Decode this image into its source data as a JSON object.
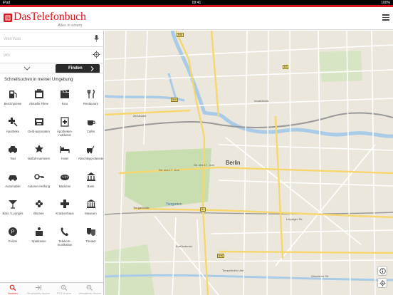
{
  "status": {
    "left": "iPad",
    "time": "09:41",
    "right": "100%"
  },
  "header": {
    "logo": "DasTelefonbuch",
    "tagline": "Alles in einem"
  },
  "search": {
    "what_placeholder": "Wer/Was",
    "where_placeholder": "Wo",
    "find_label": "Finden"
  },
  "quick": {
    "title": "Schnellsuchen in meiner Umgebung",
    "items": [
      {
        "label": "Benzinpreise",
        "icon": "gas-station-icon"
      },
      {
        "label": "Aktuelle Filme",
        "icon": "film-icon"
      },
      {
        "label": "Kino",
        "icon": "clapperboard-icon"
      },
      {
        "label": "Restaurant",
        "icon": "cutlery-icon"
      },
      {
        "label": "Apotheke",
        "icon": "pharmacy-icon"
      },
      {
        "label": "Geld-automaten",
        "icon": "atm-icon"
      },
      {
        "label": "Apotheken-notdienst",
        "icon": "pharmacy-emergency-icon"
      },
      {
        "label": "Cafés",
        "icon": "coffee-cup-icon"
      },
      {
        "label": "Taxi",
        "icon": "taxi-icon"
      },
      {
        "label": "Notfall-nummern",
        "icon": "emergency-icon"
      },
      {
        "label": "Hotel",
        "icon": "hotel-bed-icon"
      },
      {
        "label": "Abschlepp-dienste",
        "icon": "tow-truck-icon"
      },
      {
        "label": "Automobile",
        "icon": "car-icon"
      },
      {
        "label": "Autoren-Helfung",
        "icon": "key-icon"
      },
      {
        "label": "Bäckerei",
        "icon": "bread-icon"
      },
      {
        "label": "Bank",
        "icon": "bank-icon"
      },
      {
        "label": "Bars / Lounges",
        "icon": "cocktail-icon"
      },
      {
        "label": "Blumen",
        "icon": "flower-icon"
      },
      {
        "label": "Krankenhaus",
        "icon": "hospital-icon"
      },
      {
        "label": "Museum",
        "icon": "museum-icon"
      },
      {
        "label": "Polizei",
        "icon": "police-icon"
      },
      {
        "label": "Sparkasse",
        "icon": "savings-bank-icon"
      },
      {
        "label": "Telekom-munikation",
        "icon": "phone-icon"
      },
      {
        "label": "Theater",
        "icon": "theater-masks-icon"
      }
    ]
  },
  "tabs": [
    {
      "label": "Suchen",
      "icon": "search-icon",
      "active": true
    },
    {
      "label": "Rückwärts-Suche",
      "icon": "reverse-search-icon",
      "active": false
    },
    {
      "label": "PLZ-Suche",
      "icon": "zip-search-icon",
      "active": false
    },
    {
      "label": "Verwaltete-Suche",
      "icon": "managed-search-icon",
      "active": false
    }
  ],
  "map": {
    "city": "Berlin",
    "park": "Tiergarten",
    "streets": [
      "Str. des 17. Juni",
      "Str. des 17. Juni",
      "Tiergartenstr.",
      "Alt-Moabit",
      "Invalidenstr.",
      "Leipziger Str.",
      "Tempelhofer Ufer",
      "Gitschiner Str.",
      "Kurfürstenstr."
    ],
    "shields": [
      "B96",
      "B1",
      "B96",
      "B96",
      "B2"
    ]
  },
  "colors": {
    "brand_red": "#d9161e",
    "map_bg": "#ece7dc",
    "park": "#c9deb0",
    "water": "#a9cbe8"
  }
}
